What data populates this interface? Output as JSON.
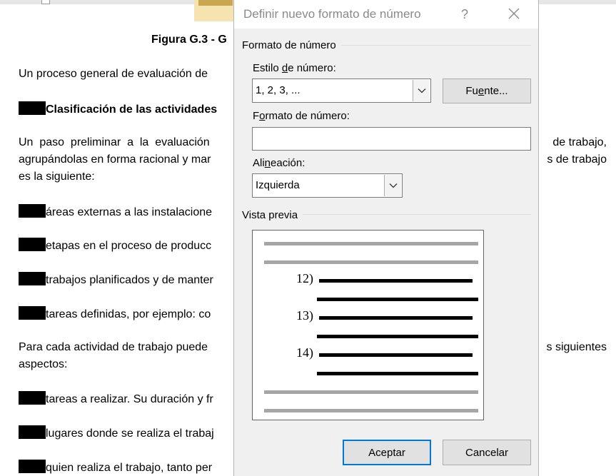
{
  "document": {
    "figure_title": "Figura G.3 - G",
    "p1": "Un proceso general de evaluación de",
    "heading": "Clasificación de las actividades",
    "p2_line1_left": "Un  paso  preliminar  a  la  evaluación",
    "p2_line1_right": "de  trabajo,",
    "p2_line2_left": "agrupándolas en forma racional y mar",
    "p2_line2_right": "s de trabajo",
    "p2_line3": "es la siguiente:",
    "list1": [
      "áreas externas a las instalacione",
      "etapas en el proceso de producc",
      "trabajos planificados y de manter",
      "tareas definidas, por ejemplo: co"
    ],
    "p3_line1_left": "Para cada actividad de trabajo puede",
    "p3_line1_right": "s siguientes",
    "p3_line2": "aspectos:",
    "list2": [
      "tareas a realizar. Su duración y fr",
      "lugares donde se realiza el trabaj",
      "quien realiza el trabajo, tanto per"
    ]
  },
  "dialog": {
    "title": "Definir nuevo formato de número",
    "help": "?",
    "section_format": "Formato de número",
    "style_label": {
      "pre": "Estilo ",
      "key": "d",
      "post": "e número:"
    },
    "style_value": "1, 2, 3, ...",
    "font_button": {
      "pre": "Fu",
      "key": "e",
      "post": "nte..."
    },
    "format_label": {
      "pre": "F",
      "key": "o",
      "post": "rmato de número:"
    },
    "format_value": "",
    "align_label": {
      "pre": "Ali",
      "key": "n",
      "post": "eación:"
    },
    "align_value": "Izquierda",
    "section_preview": "Vista previa",
    "preview_numbers": [
      "12)",
      "13)",
      "14)"
    ],
    "ok_button": "Aceptar",
    "cancel_button": "Cancelar"
  },
  "colors": {
    "dialog_bg": "#f0f0f0",
    "accent": "#0078d7",
    "title_text": "#8a8a8a"
  }
}
